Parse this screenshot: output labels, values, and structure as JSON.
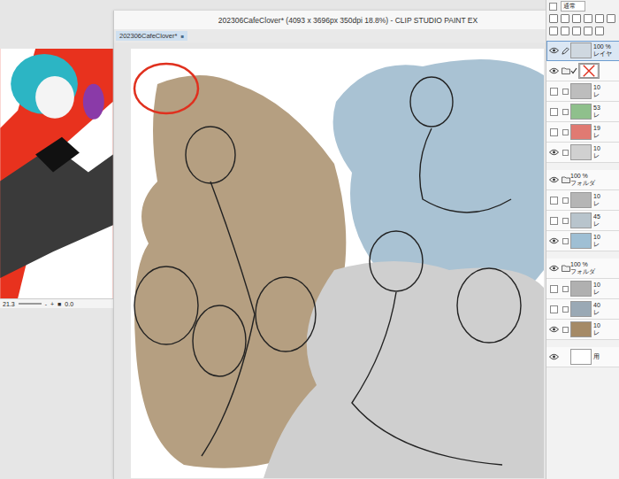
{
  "side_window": {
    "zoom": "21.3",
    "zoom_out": "-",
    "zoom_in": "+",
    "fit": "■",
    "rotation": "0.0"
  },
  "main_window": {
    "title": "202306CafeClover* (4093 x 3696px 350dpi 18.8%) - CLIP STUDIO PAINT EX",
    "tabs": [
      {
        "label": "202306CafeClover*",
        "close": "■",
        "selected": true
      }
    ]
  },
  "layer_panel": {
    "blend_mode": "通常",
    "layers": [
      {
        "kind": "layer",
        "opacity": "100 %",
        "name": "レイヤ",
        "visible": true,
        "selected": true,
        "in_folder": false,
        "color": "#cfd8e0"
      },
      {
        "kind": "mask-folder",
        "visible": true,
        "selected": false,
        "in_folder": false,
        "color": "#ffffff"
      },
      {
        "kind": "layer",
        "opacity": "10",
        "name": "レ",
        "visible": false,
        "selected": false,
        "in_folder": true,
        "color": "#bdbdbd"
      },
      {
        "kind": "layer",
        "opacity": "53",
        "name": "レ",
        "visible": false,
        "selected": false,
        "in_folder": true,
        "color": "#8fc08c"
      },
      {
        "kind": "layer",
        "opacity": "19",
        "name": "レ",
        "visible": false,
        "selected": false,
        "in_folder": true,
        "color": "#e07a72"
      },
      {
        "kind": "layer",
        "opacity": "10",
        "name": "レ",
        "visible": true,
        "selected": false,
        "in_folder": true,
        "color": "#d0d0d0"
      },
      {
        "kind": "folder",
        "opacity": "100 %",
        "name": "フォルダ",
        "visible": true,
        "selected": false,
        "in_folder": false,
        "color": "#ffffff"
      },
      {
        "kind": "layer",
        "opacity": "10",
        "name": "レ",
        "visible": false,
        "selected": false,
        "in_folder": true,
        "color": "#b5b5b5"
      },
      {
        "kind": "layer",
        "opacity": "45",
        "name": "レ",
        "visible": false,
        "selected": false,
        "in_folder": true,
        "color": "#b8c4cc"
      },
      {
        "kind": "layer",
        "opacity": "10",
        "name": "レ",
        "visible": true,
        "selected": false,
        "in_folder": true,
        "color": "#9fbfd4"
      },
      {
        "kind": "folder",
        "opacity": "100 %",
        "name": "フォルダ",
        "visible": true,
        "selected": false,
        "in_folder": false,
        "color": "#ffffff"
      },
      {
        "kind": "layer",
        "opacity": "10",
        "name": "レ",
        "visible": false,
        "selected": false,
        "in_folder": true,
        "color": "#b0b0b0"
      },
      {
        "kind": "layer",
        "opacity": "40",
        "name": "レ",
        "visible": false,
        "selected": false,
        "in_folder": true,
        "color": "#9aa9b5"
      },
      {
        "kind": "layer",
        "opacity": "10",
        "name": "レ",
        "visible": true,
        "selected": false,
        "in_folder": true,
        "color": "#a58a66"
      },
      {
        "kind": "paper",
        "name": "用",
        "visible": true,
        "selected": false,
        "in_folder": false,
        "color": "#ffffff"
      }
    ]
  }
}
